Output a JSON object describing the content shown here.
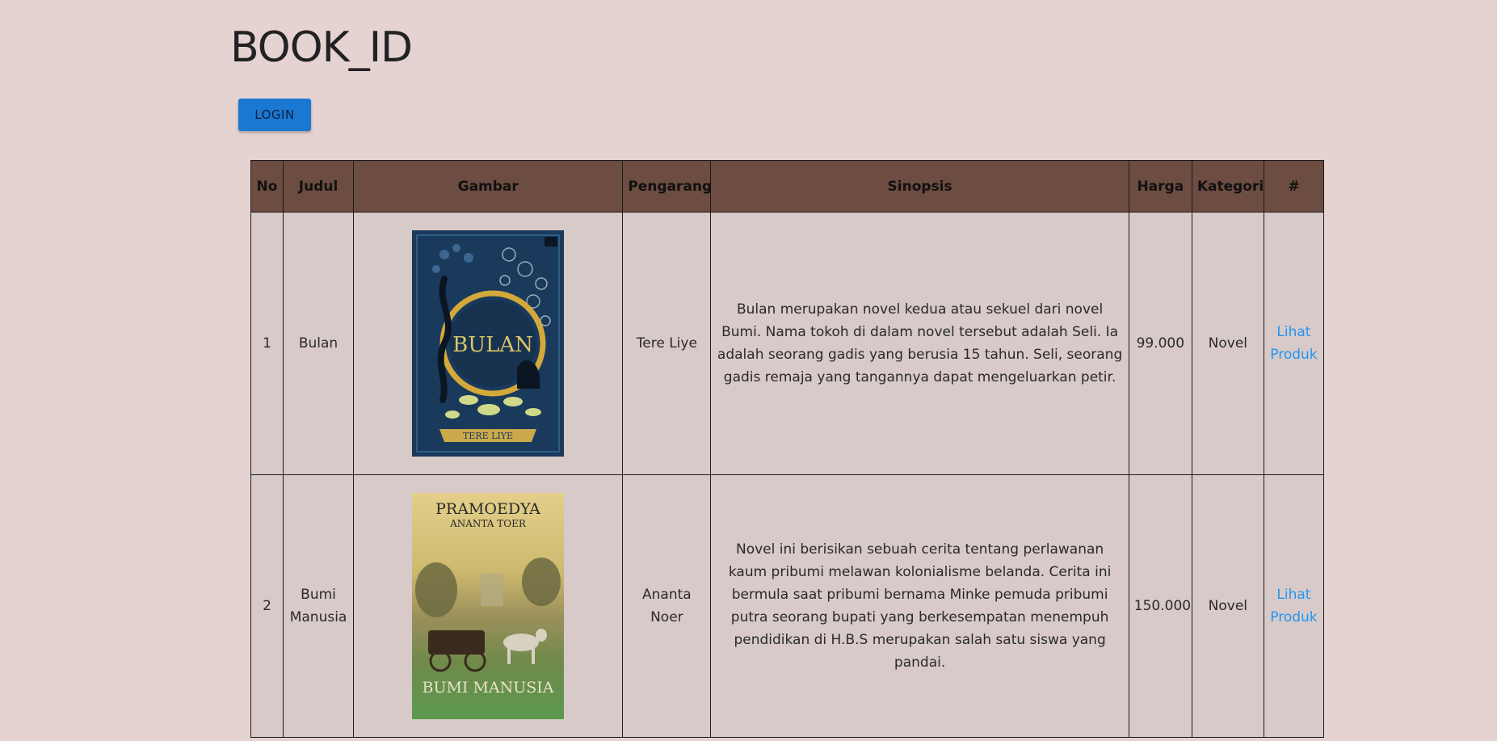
{
  "header": {
    "title": "BOOK_ID",
    "login_label": "LOGIN"
  },
  "table": {
    "columns": [
      "No",
      "Judul",
      "Gambar",
      "Pengarang",
      "Sinopsis",
      "Harga",
      "Kategori",
      "#"
    ],
    "rows": [
      {
        "no": "1",
        "judul": "Bulan",
        "cover": {
          "title": "BULAN",
          "author": "TERE LIYE",
          "colors": {
            "bg": "#1a3a5c",
            "accent": "#d8c56a",
            "gold": "#c9a94a"
          }
        },
        "pengarang": "Tere Liye",
        "sinopsis": "Bulan merupakan novel kedua atau sekuel dari novel Bumi. Nama tokoh di dalam novel tersebut adalah Seli. Ia adalah seorang gadis yang berusia 15 tahun. Seli, seorang gadis remaja yang tangannya dapat mengeluarkan petir.",
        "harga": "99.000",
        "kategori": "Novel",
        "aksi": "Lihat Produk"
      },
      {
        "no": "2",
        "judul": "Bumi Manusia",
        "cover": {
          "author_top": "PRAMOEDYA",
          "author_bottom": "ANANTA TOER",
          "title": "BUMI MANUSIA",
          "colors": {
            "top": "#d9c27a",
            "mid": "#8a8a55",
            "bottom": "#5c8f4a"
          }
        },
        "pengarang": "Ananta Noer",
        "sinopsis": "Novel ini berisikan sebuah cerita tentang perlawanan kaum pribumi melawan kolonialisme belanda. Cerita ini bermula saat pribumi bernama Minke pemuda pribumi putra seorang bupati yang berkesempatan menempuh pendidikan di H.B.S merupakan salah satu siswa yang pandai.",
        "harga": "150.000",
        "kategori": "Novel",
        "aksi": "Lihat Produk"
      }
    ]
  },
  "colors": {
    "page_bg": "#e4d3d1",
    "header_bg": "#6d4c41",
    "row_bg": "#d7cac8",
    "button_bg": "#1a77d2",
    "link": "#2196f3"
  }
}
